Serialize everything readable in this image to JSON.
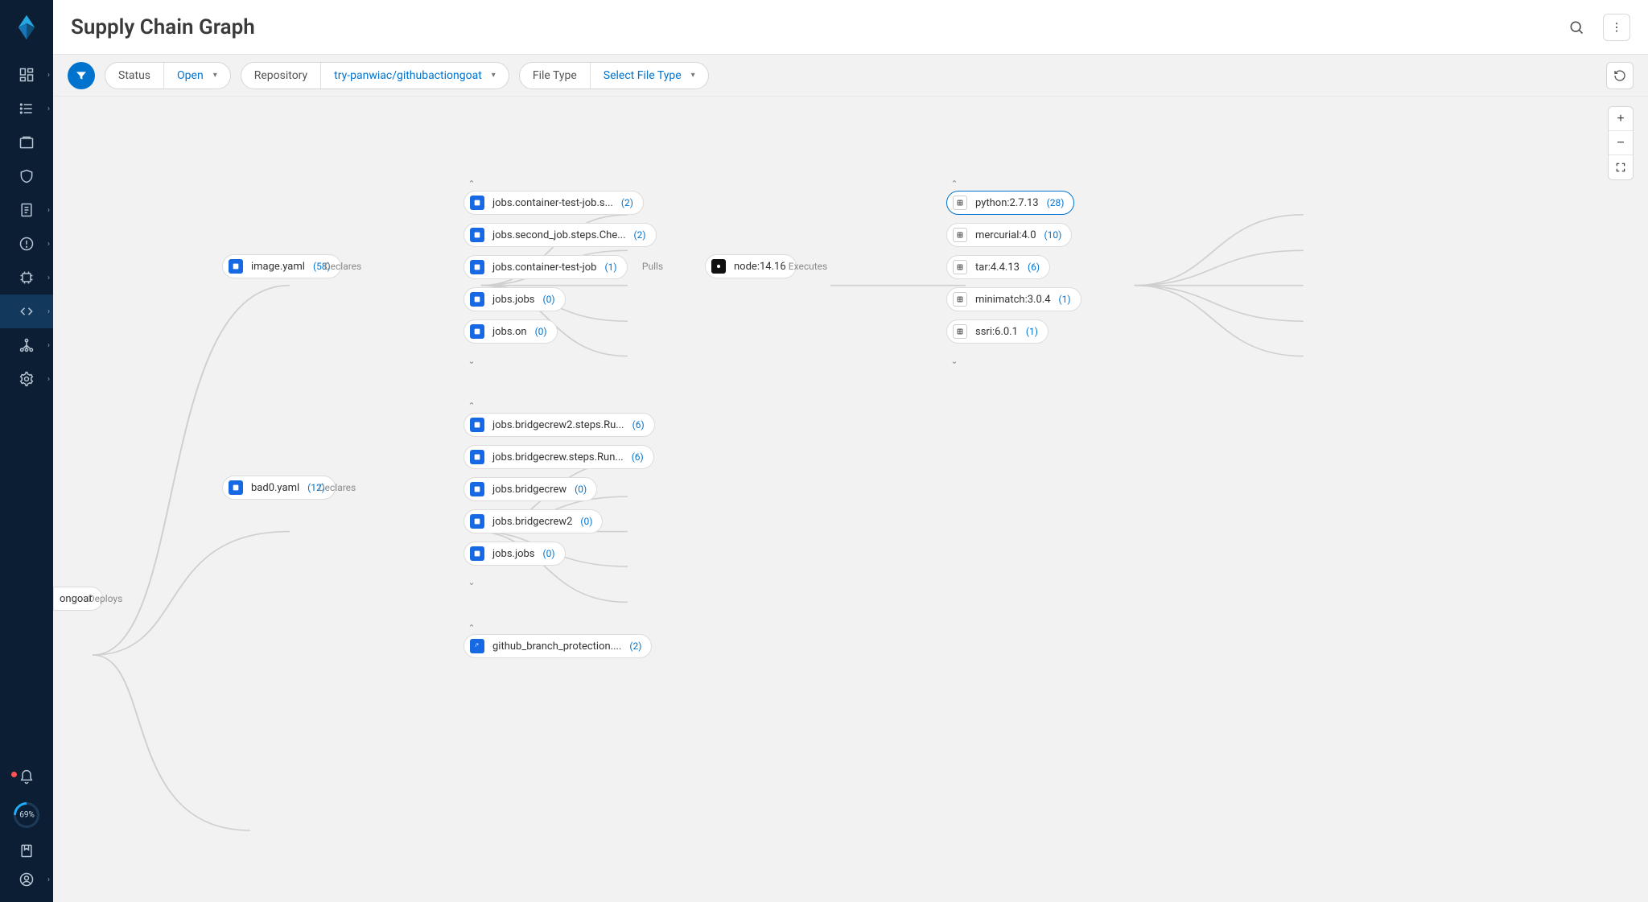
{
  "header": {
    "title": "Supply Chain Graph"
  },
  "filters": {
    "status_label": "Status",
    "status_value": "Open",
    "repo_label": "Repository",
    "repo_value": "try-panwiac/githubactiongoat",
    "filetype_label": "File Type",
    "filetype_value": "Select File Type"
  },
  "sidebar": {
    "progress": "69%"
  },
  "graph": {
    "root": {
      "label": "ongoat",
      "edge": "Deploys"
    },
    "imageYaml": {
      "label": "image.yaml",
      "count": "58",
      "edge": "Declares"
    },
    "bad0Yaml": {
      "label": "bad0.yaml",
      "count": "12",
      "edge": "Declares"
    },
    "group_image_jobs": [
      {
        "label": "jobs.container-test-job.s...",
        "count": "2"
      },
      {
        "label": "jobs.second_job.steps.Che...",
        "count": "2"
      },
      {
        "label": "jobs.container-test-job",
        "count": "1"
      },
      {
        "label": "jobs.jobs",
        "count": "0"
      },
      {
        "label": "jobs.on",
        "count": "0"
      }
    ],
    "pullsEdge": "Pulls",
    "node1416": {
      "label": "node:14.16",
      "edge": "Executes"
    },
    "packages": [
      {
        "label": "python:2.7.13",
        "count": "28",
        "selected": true
      },
      {
        "label": "mercurial:4.0",
        "count": "10"
      },
      {
        "label": "tar:4.4.13",
        "count": "6"
      },
      {
        "label": "minimatch:3.0.4",
        "count": "1"
      },
      {
        "label": "ssri:6.0.1",
        "count": "1"
      }
    ],
    "group_bad0_jobs": [
      {
        "label": "jobs.bridgecrew2.steps.Ru...",
        "count": "6"
      },
      {
        "label": "jobs.bridgecrew.steps.Run...",
        "count": "6"
      },
      {
        "label": "jobs.bridgecrew",
        "count": "0"
      },
      {
        "label": "jobs.bridgecrew2",
        "count": "0"
      },
      {
        "label": "jobs.jobs",
        "count": "0"
      }
    ],
    "bottom_job": {
      "label": "github_branch_protection....",
      "count": "2"
    }
  }
}
